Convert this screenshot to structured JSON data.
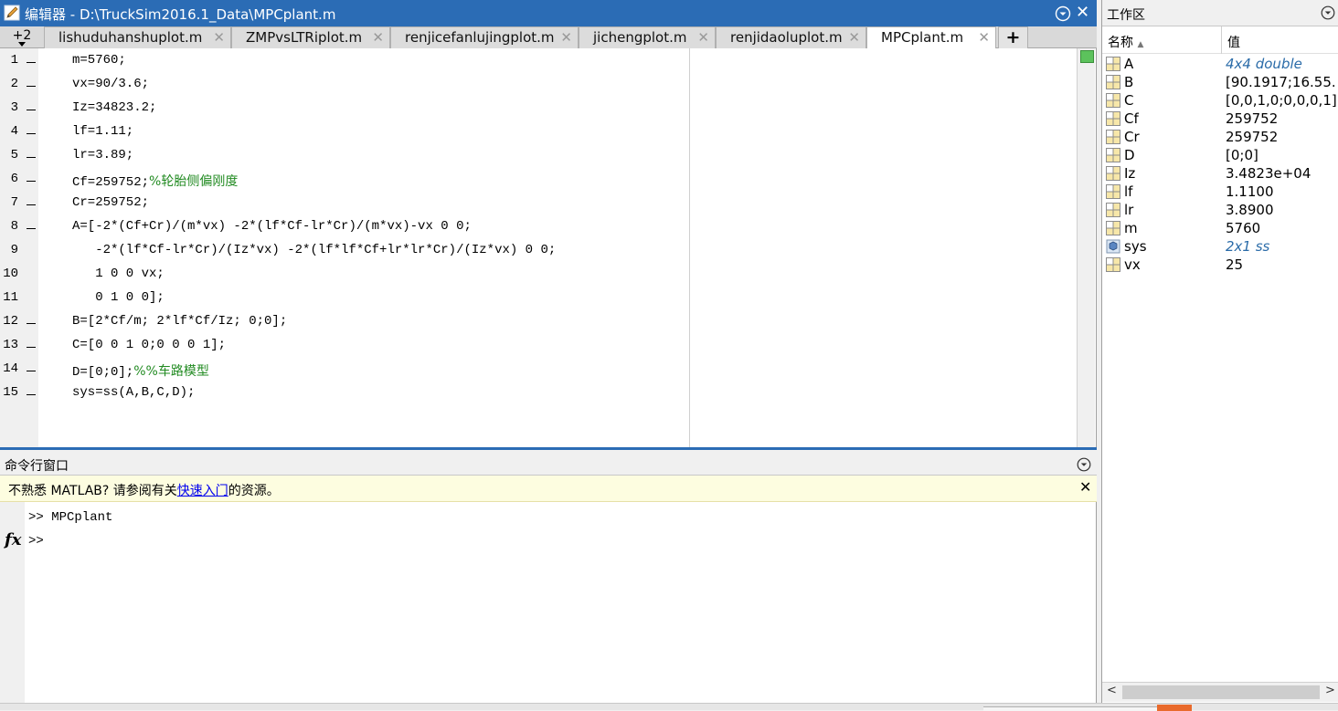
{
  "editor": {
    "title": "编辑器 - D:\\TruckSim2016.1_Data\\MPCplant.m",
    "more_tabs": "+2",
    "tabs": [
      {
        "label": "lishuduhanshuplot.m",
        "active": false
      },
      {
        "label": "ZMPvsLTRiplot.m",
        "active": false
      },
      {
        "label": "renjicefanlujingplot.m",
        "active": false
      },
      {
        "label": "jichengplot.m",
        "active": false
      },
      {
        "label": "renjidaoluplot.m",
        "active": false
      },
      {
        "label": "MPCplant.m",
        "active": true
      }
    ],
    "add_tab_label": "+",
    "lines": [
      {
        "n": "1",
        "bp": true,
        "code": "m=5760;",
        "comment": ""
      },
      {
        "n": "2",
        "bp": true,
        "code": "vx=90/3.6;",
        "comment": ""
      },
      {
        "n": "3",
        "bp": true,
        "code": "Iz=34823.2;",
        "comment": ""
      },
      {
        "n": "4",
        "bp": true,
        "code": "lf=1.11;",
        "comment": ""
      },
      {
        "n": "5",
        "bp": true,
        "code": "lr=3.89;",
        "comment": ""
      },
      {
        "n": "6",
        "bp": true,
        "code": "Cf=259752;",
        "comment": "%轮胎侧偏刚度"
      },
      {
        "n": "7",
        "bp": true,
        "code": "Cr=259752;",
        "comment": ""
      },
      {
        "n": "8",
        "bp": true,
        "code": "A=[-2*(Cf+Cr)/(m*vx) -2*(lf*Cf-lr*Cr)/(m*vx)-vx 0 0;",
        "comment": ""
      },
      {
        "n": "9",
        "bp": false,
        "code": "   -2*(lf*Cf-lr*Cr)/(Iz*vx) -2*(lf*lf*Cf+lr*lr*Cr)/(Iz*vx) 0 0;",
        "comment": ""
      },
      {
        "n": "10",
        "bp": false,
        "code": "   1 0 0 vx;",
        "comment": ""
      },
      {
        "n": "11",
        "bp": false,
        "code": "   0 1 0 0];",
        "comment": ""
      },
      {
        "n": "12",
        "bp": true,
        "code": "B=[2*Cf/m; 2*lf*Cf/Iz; 0;0];",
        "comment": ""
      },
      {
        "n": "13",
        "bp": true,
        "code": "C=[0 0 1 0;0 0 0 1];",
        "comment": ""
      },
      {
        "n": "14",
        "bp": true,
        "code": "D=[0;0];",
        "comment": "%%车路模型"
      },
      {
        "n": "15",
        "bp": true,
        "code": "sys=ss(A,B,C,D);",
        "comment": ""
      }
    ]
  },
  "command_window": {
    "title": "命令行窗口",
    "notice_before": "不熟悉 MATLAB? 请参阅有关",
    "notice_link": "快速入门",
    "notice_after": "的资源。",
    "lines": [
      ">> MPCplant",
      ">>"
    ]
  },
  "workspace": {
    "title": "工作区",
    "col_name": "名称",
    "col_value": "值",
    "variables": [
      {
        "name": "A",
        "value": "4x4 double",
        "italic": true,
        "icon": "matrix-icon"
      },
      {
        "name": "B",
        "value": "[90.1917;16.55...",
        "italic": false,
        "icon": "matrix-icon"
      },
      {
        "name": "C",
        "value": "[0,0,1,0;0,0,0,1]",
        "italic": false,
        "icon": "matrix-icon"
      },
      {
        "name": "Cf",
        "value": "259752",
        "italic": false,
        "icon": "matrix-icon"
      },
      {
        "name": "Cr",
        "value": "259752",
        "italic": false,
        "icon": "matrix-icon"
      },
      {
        "name": "D",
        "value": "[0;0]",
        "italic": false,
        "icon": "matrix-icon"
      },
      {
        "name": "Iz",
        "value": "3.4823e+04",
        "italic": false,
        "icon": "matrix-icon"
      },
      {
        "name": "lf",
        "value": "1.1100",
        "italic": false,
        "icon": "matrix-icon"
      },
      {
        "name": "lr",
        "value": "3.8900",
        "italic": false,
        "icon": "matrix-icon"
      },
      {
        "name": "m",
        "value": "5760",
        "italic": false,
        "icon": "matrix-icon"
      },
      {
        "name": "sys",
        "value": "2x1 ss",
        "italic": true,
        "icon": "object-icon"
      },
      {
        "name": "vx",
        "value": "25",
        "italic": false,
        "icon": "matrix-icon"
      }
    ]
  },
  "colors": {
    "title_bar": "#2b6cb5",
    "comment": "#228b22",
    "notice_bg": "#fdfde0",
    "status_ok": "#5cc25c"
  }
}
